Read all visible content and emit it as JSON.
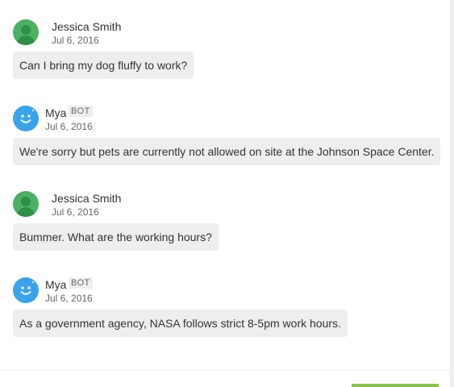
{
  "messages": [
    {
      "sender": "Jessica Smith",
      "date": "Jul 6, 2016",
      "text": "Can I bring my dog fluffy to work?"
    },
    {
      "sender": "Mya",
      "badge": "BOT",
      "date": "Jul 6, 2016",
      "text": "We're sorry but pets are currently not allowed on site at the Johnson Space Center."
    },
    {
      "sender": "Jessica Smith",
      "date": "Jul 6, 2016",
      "text": "Bummer. What are the working hours?"
    },
    {
      "sender": "Mya",
      "badge": "BOT",
      "date": "Jul 6, 2016",
      "text": "As a government agency, NASA follows strict 8-5pm work hours."
    }
  ],
  "colors": {
    "user_avatar": "#4caf63",
    "bot_avatar": "#3ba3ec",
    "bubble": "#eeeeee",
    "action_button": "#8bc34a"
  }
}
